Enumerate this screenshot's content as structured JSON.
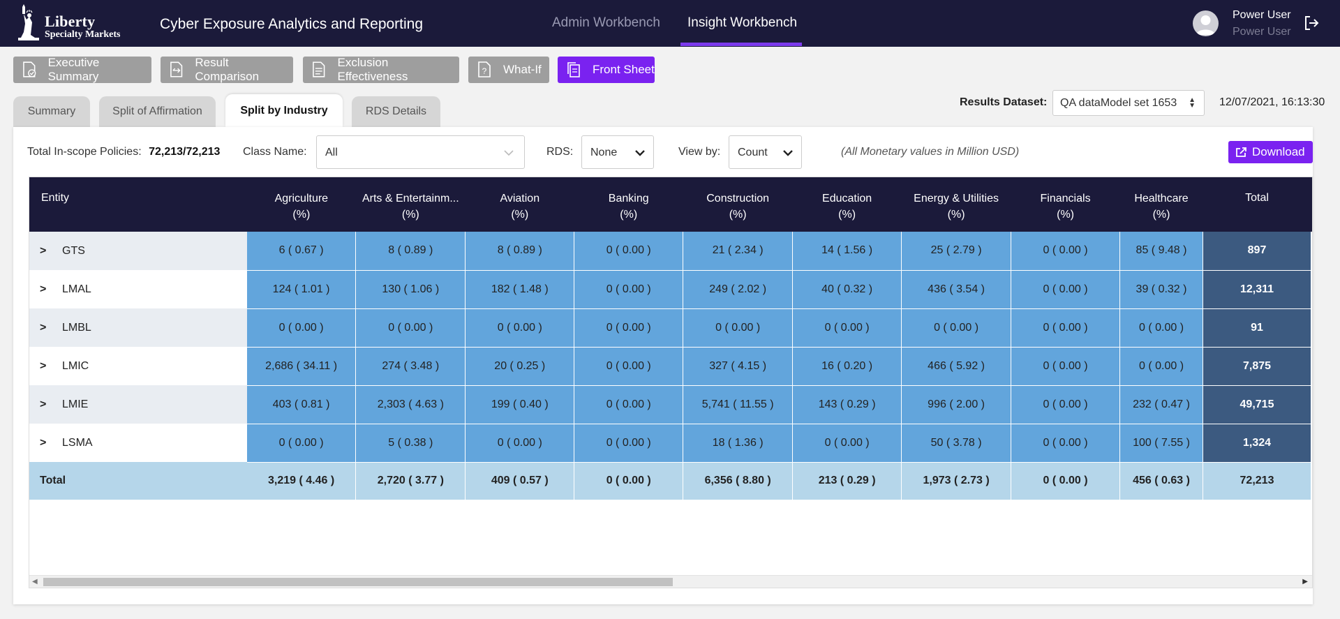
{
  "brand": {
    "logo_line1": "Liberty",
    "logo_line2": "Specialty Markets",
    "app_title": "Cyber Exposure Analytics and Reporting"
  },
  "nav": {
    "tabs": [
      {
        "label": "Admin Workbench",
        "active": false
      },
      {
        "label": "Insight Workbench",
        "active": true
      }
    ]
  },
  "user": {
    "name": "Power User",
    "role": "Power User"
  },
  "toolbar": {
    "buttons": [
      {
        "label": "Executive Summary",
        "icon": "document-check-icon"
      },
      {
        "label": "Result Comparison",
        "icon": "compare-icon"
      },
      {
        "label": "Exclusion Effectiveness",
        "icon": "document-icon"
      },
      {
        "label": "What-If",
        "icon": "question-doc-icon"
      },
      {
        "label": "Front Sheet",
        "icon": "copy-doc-icon",
        "active": true
      }
    ]
  },
  "subtabs": [
    {
      "label": "Summary"
    },
    {
      "label": "Split of Affirmation"
    },
    {
      "label": "Split by Industry",
      "active": true
    },
    {
      "label": "RDS Details"
    }
  ],
  "results_dataset": {
    "label": "Results Dataset:",
    "value": "QA dataModel set 1653",
    "timestamp": "12/07/2021, 16:13:30"
  },
  "filters": {
    "policies_label": "Total In-scope Policies:",
    "policies_value": "72,213/72,213",
    "class_label": "Class Name:",
    "class_value": "All",
    "rds_label": "RDS:",
    "rds_value": "None",
    "viewby_label": "View by:",
    "viewby_value": "Count",
    "note": "(All Monetary values in Million USD)",
    "download_label": "Download"
  },
  "table": {
    "entity_header": "Entity",
    "pct_label": "(%)",
    "columns": [
      "Agriculture",
      "Arts & Entertainm...",
      "Aviation",
      "Banking",
      "Construction",
      "Education",
      "Energy & Utilities",
      "Financials",
      "Healthcare"
    ],
    "total_header": "Total",
    "rows": [
      {
        "entity": "GTS",
        "values": [
          "6 ( 0.67 )",
          "8 ( 0.89 )",
          "8 ( 0.89 )",
          "0 ( 0.00 )",
          "21 ( 2.34 )",
          "14 ( 1.56 )",
          "25 ( 2.79 )",
          "0 ( 0.00 )",
          "85 ( 9.48 )"
        ],
        "total": "897"
      },
      {
        "entity": "LMAL",
        "values": [
          "124 ( 1.01 )",
          "130 ( 1.06 )",
          "182 ( 1.48 )",
          "0 ( 0.00 )",
          "249 ( 2.02 )",
          "40 ( 0.32 )",
          "436 ( 3.54 )",
          "0 ( 0.00 )",
          "39 ( 0.32 )"
        ],
        "total": "12,311"
      },
      {
        "entity": "LMBL",
        "values": [
          "0 ( 0.00 )",
          "0 ( 0.00 )",
          "0 ( 0.00 )",
          "0 ( 0.00 )",
          "0 ( 0.00 )",
          "0 ( 0.00 )",
          "0 ( 0.00 )",
          "0 ( 0.00 )",
          "0 ( 0.00 )"
        ],
        "total": "91"
      },
      {
        "entity": "LMIC",
        "values": [
          "2,686 ( 34.11 )",
          "274 ( 3.48 )",
          "20 ( 0.25 )",
          "0 ( 0.00 )",
          "327 ( 4.15 )",
          "16 ( 0.20 )",
          "466 ( 5.92 )",
          "0 ( 0.00 )",
          "0 ( 0.00 )"
        ],
        "total": "7,875"
      },
      {
        "entity": "LMIE",
        "values": [
          "403 ( 0.81 )",
          "2,303 ( 4.63 )",
          "199 ( 0.40 )",
          "0 ( 0.00 )",
          "5,741 ( 11.55 )",
          "143 ( 0.29 )",
          "996 ( 2.00 )",
          "0 ( 0.00 )",
          "232 ( 0.47 )"
        ],
        "total": "49,715"
      },
      {
        "entity": "LSMA",
        "values": [
          "0 ( 0.00 )",
          "5 ( 0.38 )",
          "0 ( 0.00 )",
          "0 ( 0.00 )",
          "18 ( 1.36 )",
          "0 ( 0.00 )",
          "50 ( 3.78 )",
          "0 ( 0.00 )",
          "100 ( 7.55 )"
        ],
        "total": "1,324"
      }
    ],
    "total_row": {
      "label": "Total",
      "values": [
        "3,219 ( 4.46 )",
        "2,720 ( 3.77 )",
        "409 ( 0.57 )",
        "0 ( 0.00 )",
        "6,356 ( 8.80 )",
        "213 ( 0.29 )",
        "1,973 ( 2.73 )",
        "0 ( 0.00 )",
        "456 ( 0.63 )"
      ],
      "total": "72,213"
    }
  },
  "colors": {
    "header_bg": "#1b1a3a",
    "accent": "#7a22f0",
    "cell": "#62a5dc",
    "total_col": "#3c5a80",
    "total_row": "#b5d6ea"
  }
}
